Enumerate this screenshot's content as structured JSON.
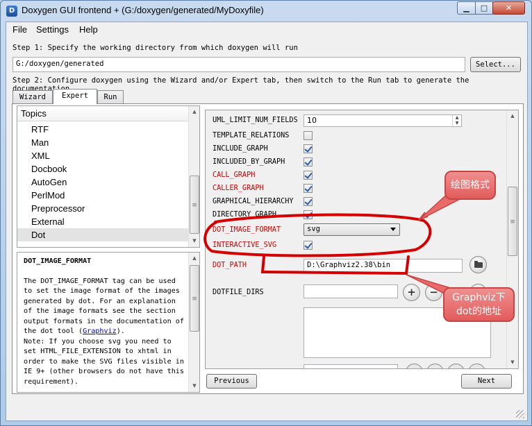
{
  "window": {
    "title": "Doxygen GUI frontend + (G:/doxygen/generated/MyDoxyfile)",
    "app_icon": "doxygen-icon",
    "controls": {
      "minimize": "▁",
      "maximize": "□",
      "close": "✕"
    }
  },
  "menubar": {
    "items": [
      "File",
      "Settings",
      "Help"
    ]
  },
  "step1": {
    "label": "Step 1: Specify the working directory from which doxygen will run",
    "value": "G:/doxygen/generated",
    "button": "Select..."
  },
  "step2": {
    "label": "Step 2: Configure doxygen using the Wizard and/or Expert tab, then switch to the Run tab to generate the documentation"
  },
  "tabs": [
    {
      "label": "Wizard",
      "active": false
    },
    {
      "label": "Expert",
      "active": true
    },
    {
      "label": "Run",
      "active": false
    }
  ],
  "topics": {
    "header": "Topics",
    "items": [
      "RTF",
      "Man",
      "XML",
      "Docbook",
      "AutoGen",
      "PerlMod",
      "Preprocessor",
      "External",
      "Dot"
    ],
    "selected": "Dot"
  },
  "help": {
    "title": "DOT_IMAGE_FORMAT",
    "para1_before": "The DOT_IMAGE_FORMAT tag can be used to set the image format of the images generated by dot. For an explanation of the image formats see the section output formats in the documentation of the dot tool (",
    "para1_link": "Graphviz",
    "para1_after": ").",
    "para2": "Note: If you choose svg you need to set HTML_FILE_EXTENSION to xhtml in order to make the SVG files visible in IE 9+ (other browsers do not have this requirement)."
  },
  "settings": {
    "uml_limit": {
      "label": "UML_LIMIT_NUM_FIELDS",
      "value": "10"
    },
    "checkboxes": [
      {
        "label": "TEMPLATE_RELATIONS",
        "checked": false,
        "red": false
      },
      {
        "label": "INCLUDE_GRAPH",
        "checked": true,
        "red": false
      },
      {
        "label": "INCLUDED_BY_GRAPH",
        "checked": true,
        "red": false
      },
      {
        "label": "CALL_GRAPH",
        "checked": true,
        "red": true
      },
      {
        "label": "CALLER_GRAPH",
        "checked": true,
        "red": true
      },
      {
        "label": "GRAPHICAL_HIERARCHY",
        "checked": true,
        "red": false
      },
      {
        "label": "DIRECTORY_GRAPH",
        "checked": true,
        "red": false
      }
    ],
    "dot_image_format": {
      "label": "DOT_IMAGE_FORMAT",
      "value": "svg"
    },
    "interactive_svg": {
      "label": "INTERACTIVE_SVG",
      "checked": true
    },
    "dot_path": {
      "label": "DOT_PATH",
      "value": "D:\\Graphviz2.38\\bin"
    },
    "dotfile_dirs": {
      "label": "DOTFILE_DIRS",
      "add": "+",
      "remove": "−"
    }
  },
  "nav": {
    "previous": "Previous",
    "next": "Next"
  },
  "annotations": {
    "format_note": "绘图格式",
    "path_note_line1": "Graphviz下",
    "path_note_line2": "dot的地址"
  },
  "colors": {
    "annotation_red": "#d40000",
    "callout_fill": "#e86a6a",
    "label_red": "#d00000"
  }
}
